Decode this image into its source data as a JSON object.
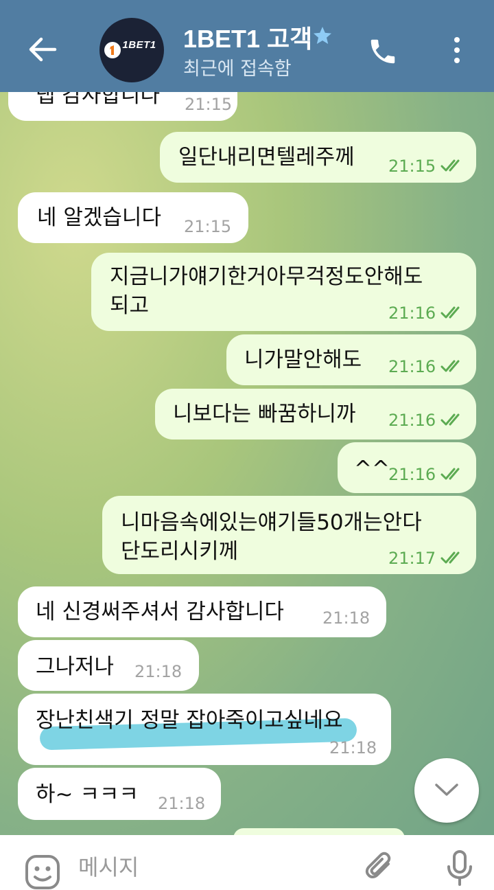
{
  "header": {
    "back_icon": "arrow-left-icon",
    "avatar_text": "1BET1",
    "title": "1BET1 고객",
    "verified_icon": "star-icon",
    "subtitle": "최근에 접속함",
    "call_icon": "phone-icon",
    "menu_icon": "more-vertical-icon"
  },
  "messages": [
    {
      "dir": "in",
      "text": "탭 감사합니다",
      "time": "21:15"
    },
    {
      "dir": "out",
      "text": "일단내리면텔레주께",
      "time": "21:15",
      "read": true
    },
    {
      "dir": "in",
      "text": "네 알겠습니다",
      "time": "21:15"
    },
    {
      "dir": "out",
      "lines": [
        "지금니가얘기한거아무걱정도안해도",
        "되고"
      ],
      "time": "21:16",
      "read": true
    },
    {
      "dir": "out",
      "text": "니가말안해도",
      "time": "21:16",
      "read": true
    },
    {
      "dir": "out",
      "text": "니보다는 빠꿈하니까",
      "time": "21:16",
      "read": true
    },
    {
      "dir": "out",
      "text": "^^",
      "time": "21:16",
      "read": true
    },
    {
      "dir": "out",
      "lines": [
        "니마음속에있는얘기들50개는안다",
        "단도리시키께"
      ],
      "time": "21:17",
      "read": true
    },
    {
      "dir": "in",
      "text": "네 신경써주셔서 감사합니다",
      "time": "21:18"
    },
    {
      "dir": "in",
      "text": "그나저나",
      "time": "21:18"
    },
    {
      "dir": "in",
      "text": "장난친색기 정말 잡아죽이고싶네요",
      "time": "21:18",
      "highlighted": true
    },
    {
      "dir": "in",
      "text": "하~ ㅋㅋㅋ",
      "time": "21:18"
    }
  ],
  "scroll_down_icon": "chevron-down-icon",
  "composer": {
    "emoji_icon": "emoji-icon",
    "placeholder": "메시지",
    "attach_icon": "paperclip-icon",
    "mic_icon": "microphone-icon"
  },
  "colors": {
    "header": "#517da2",
    "incoming_bubble": "#ffffff",
    "outgoing_bubble": "#effdde",
    "time_outgoing": "#5cab52",
    "highlight_marker": "#5ec9dd"
  }
}
